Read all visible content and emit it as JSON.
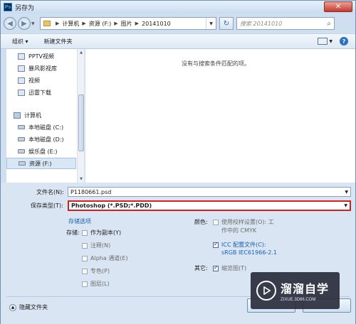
{
  "window": {
    "title": "另存为",
    "app_icon": "Ps",
    "close_glyph": "✕"
  },
  "nav": {
    "back_glyph": "◀",
    "forward_glyph": "▶",
    "breadcrumb": [
      "计算机",
      "资源 (F:)",
      "图片",
      "20141010"
    ],
    "breadcrumb_sep": "▶",
    "refresh_glyph": "↻",
    "search_placeholder": "搜索 20141010"
  },
  "toolbar": {
    "organize": "组织 ▾",
    "new_folder": "新建文件夹",
    "help": "?"
  },
  "sidebar": {
    "items": [
      {
        "label": "PPTV视频",
        "kind": "favorite"
      },
      {
        "label": "暴风影视库",
        "kind": "favorite"
      },
      {
        "label": "视频",
        "kind": "favorite"
      },
      {
        "label": "迅雷下载",
        "kind": "favorite"
      },
      {
        "label": "计算机",
        "kind": "computer"
      },
      {
        "label": "本地磁盘 (C:)",
        "kind": "drive"
      },
      {
        "label": "本地磁盘 (D:)",
        "kind": "drive"
      },
      {
        "label": "娱乐盘 (E:)",
        "kind": "drive"
      },
      {
        "label": "资源 (F:)",
        "kind": "drive",
        "selected": true
      }
    ]
  },
  "content": {
    "empty_message": "没有与搜索条件匹配的项。"
  },
  "form": {
    "filename_label": "文件名(N):",
    "filename_value": "P1180661.psd",
    "type_label": "保存类型(T):",
    "type_value": "Photoshop (*.PSD;*.PDD)",
    "save_options_link": "存储选项",
    "save_label": "存储:",
    "save_options": [
      {
        "label": "作为副本(Y)",
        "checked": false,
        "enabled": true
      },
      {
        "label": "注释(N)",
        "checked": false,
        "enabled": false
      },
      {
        "label": "Alpha 通道(E)",
        "checked": false,
        "enabled": false
      },
      {
        "label": "专色(P)",
        "checked": false,
        "enabled": false
      },
      {
        "label": "图层(L)",
        "checked": false,
        "enabled": false
      }
    ],
    "color_label": "颜色:",
    "proof_setup_line1": "使用校样设置(O): 工",
    "proof_setup_line2": "作中的 CMYK",
    "icc_line1": "ICC 配置文件(C):",
    "icc_line2": "sRGB IEC61966-2.1",
    "other_label": "其它:",
    "thumbnail_label": "缩览图(T)",
    "hide_folders": "隐藏文件夹",
    "hide_folders_glyph": "▲"
  },
  "watermark": {
    "main": "溜溜自学",
    "sub": "ZIXUE.3D66.COM"
  }
}
